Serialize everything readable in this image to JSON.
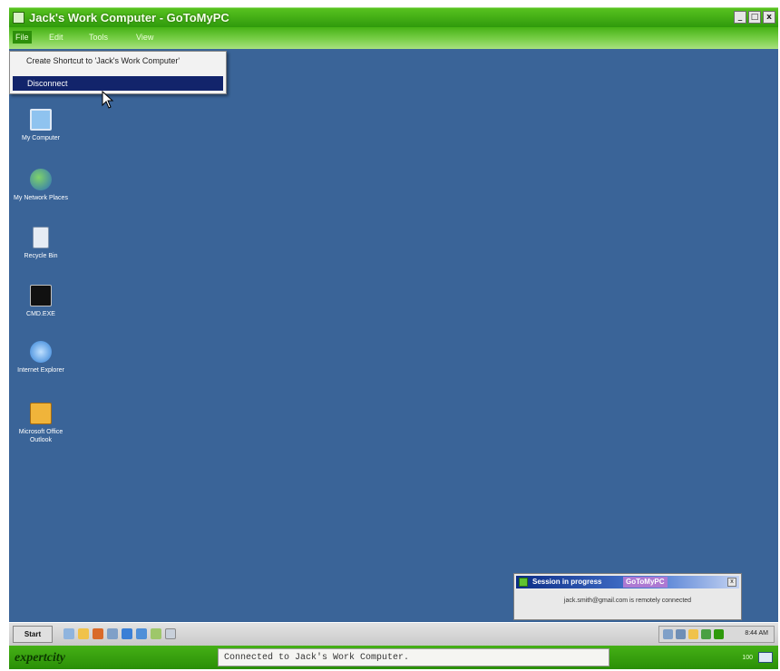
{
  "window": {
    "title": "Jack's Work Computer - GoToMyPC",
    "controls": [
      "_",
      "□",
      "x"
    ]
  },
  "menubar": {
    "items": [
      "File",
      "Edit",
      "Tools",
      "View"
    ]
  },
  "file_menu": {
    "items": [
      {
        "label": "Create Shortcut to 'Jack's Work Computer'"
      },
      {
        "label": "Disconnect",
        "highlighted": true
      }
    ]
  },
  "desktop": {
    "background": "#3a6498",
    "icons": [
      {
        "label": "My Computer",
        "icon": "my-computer-icon",
        "color": "#8fc3ef"
      },
      {
        "label": "My Network Places",
        "icon": "network-places-icon",
        "color": "#4aa043"
      },
      {
        "label": "Recycle Bin",
        "icon": "recycle-bin-icon",
        "color": "#e6ecf4"
      },
      {
        "label": "CMD.EXE",
        "icon": "command-prompt-icon",
        "color": "#111111"
      },
      {
        "label": "Internet Explorer",
        "icon": "internet-explorer-icon",
        "color": "#2f7fd6"
      },
      {
        "label": "Microsoft Office Outlook",
        "icon": "outlook-icon",
        "color": "#f0b43a"
      }
    ]
  },
  "notification": {
    "title": "Session in progress",
    "brand": "GoToMyPC",
    "message": "jack.smith@gmail.com is remotely connected"
  },
  "taskbar": {
    "start_label": "Start",
    "clock": "8:44 AM"
  },
  "statusbar": {
    "logo": "expertcity",
    "status_text": "Connected to Jack's Work Computer.",
    "right_small": "100"
  },
  "colors": {
    "title_green": "#3faa13",
    "selection_blue": "#12246b",
    "desktop_blue": "#3a6498"
  }
}
